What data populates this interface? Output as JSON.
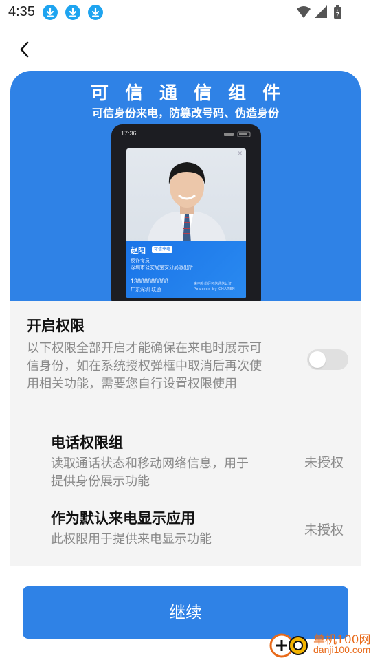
{
  "status_bar": {
    "time": "4:35",
    "notification_icons": [
      "download-icon",
      "download-icon",
      "download-icon"
    ],
    "system_icons": [
      "wifi-icon",
      "signal-icon",
      "battery-charging-icon"
    ]
  },
  "nav": {
    "back_icon": "chevron-left-icon"
  },
  "hero": {
    "title": "可信通信组件",
    "subtitle": "可信身份来电，防篡改号码、伪造身份",
    "background_color": "#2f82e6",
    "phone_preview": {
      "time": "17:36",
      "caller_name": "赵阳",
      "caller_badge": "可信来电",
      "caller_role": "反诈专员",
      "caller_org": "深圳市公安局宝安分局派出所",
      "caller_number": "13888888888",
      "caller_location": "广东深圳 联通",
      "verify_text": "来电身份经可信通信认证",
      "powered_text": "Powered by CHAREN"
    }
  },
  "permissions": {
    "title": "开启权限",
    "description": "以下权限全部开启才能确保在来电时展示可信身份，如在系统授权弹框中取消后再次使用相关功能，需要您自行设置权限使用",
    "toggle_on": false,
    "items": [
      {
        "title": "电话权限组",
        "description": "读取通话状态和移动网络信息，用于提供身份展示功能",
        "status": "未授权"
      },
      {
        "title": "作为默认来电显示应用",
        "description": "此权限用于提供来电显示功能",
        "status": "未授权"
      }
    ]
  },
  "continue_button": {
    "label": "继续",
    "color": "#2f82e6"
  },
  "watermark": {
    "name": "单机100网",
    "url": "danji100.com"
  }
}
